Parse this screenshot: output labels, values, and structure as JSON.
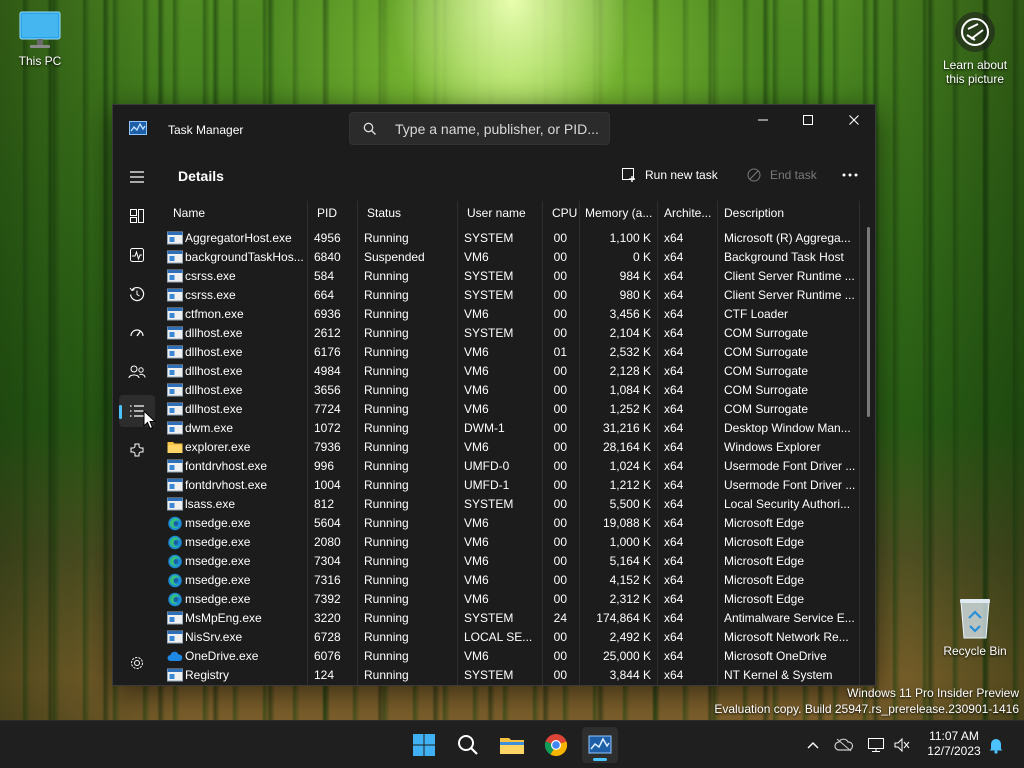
{
  "desktop": {
    "icons": [
      {
        "label": "This PC"
      },
      {
        "label": "Recycle Bin"
      }
    ],
    "learn_about": "Learn about this picture",
    "learn_line1": "Learn about",
    "learn_line2": "this picture",
    "watermark_line1": "Windows 11 Pro Insider Preview",
    "watermark_line2": "Evaluation copy. Build 25947.rs_prerelease.230901-1416"
  },
  "window": {
    "title": "Task Manager",
    "search_placeholder": "Type a name, publisher, or PID..."
  },
  "sidebar": [
    {
      "name": "hamburger-icon",
      "label": "Menu"
    },
    {
      "name": "processes-icon",
      "label": "Processes"
    },
    {
      "name": "performance-icon",
      "label": "Performance"
    },
    {
      "name": "app-history-icon",
      "label": "App history"
    },
    {
      "name": "startup-apps-icon",
      "label": "Startup apps"
    },
    {
      "name": "users-icon",
      "label": "Users"
    },
    {
      "name": "details-icon",
      "label": "Details",
      "active": true
    },
    {
      "name": "services-icon",
      "label": "Services"
    },
    {
      "name": "settings-icon",
      "label": "Settings"
    }
  ],
  "details": {
    "heading": "Details",
    "run_new_task": "Run new task",
    "end_task": "End task",
    "columns": [
      "Name",
      "PID",
      "Status",
      "User name",
      "CPU",
      "Memory (a...",
      "Archite...",
      "Description"
    ],
    "rows": [
      {
        "icon": "app-icon",
        "name": "AggregatorHost.exe",
        "pid": "4956",
        "status": "Running",
        "user": "SYSTEM",
        "cpu": "00",
        "mem": "1,100 K",
        "arch": "x64",
        "desc": "Microsoft (R) Aggrega..."
      },
      {
        "icon": "app-icon",
        "name": "backgroundTaskHos...",
        "pid": "6840",
        "status": "Suspended",
        "user": "VM6",
        "cpu": "00",
        "mem": "0 K",
        "arch": "x64",
        "desc": "Background Task Host"
      },
      {
        "icon": "app-icon",
        "name": "csrss.exe",
        "pid": "584",
        "status": "Running",
        "user": "SYSTEM",
        "cpu": "00",
        "mem": "984 K",
        "arch": "x64",
        "desc": "Client Server Runtime ..."
      },
      {
        "icon": "app-icon",
        "name": "csrss.exe",
        "pid": "664",
        "status": "Running",
        "user": "SYSTEM",
        "cpu": "00",
        "mem": "980 K",
        "arch": "x64",
        "desc": "Client Server Runtime ..."
      },
      {
        "icon": "app-icon",
        "name": "ctfmon.exe",
        "pid": "6936",
        "status": "Running",
        "user": "VM6",
        "cpu": "00",
        "mem": "3,456 K",
        "arch": "x64",
        "desc": "CTF Loader"
      },
      {
        "icon": "app-icon",
        "name": "dllhost.exe",
        "pid": "2612",
        "status": "Running",
        "user": "SYSTEM",
        "cpu": "00",
        "mem": "2,104 K",
        "arch": "x64",
        "desc": "COM Surrogate"
      },
      {
        "icon": "app-icon",
        "name": "dllhost.exe",
        "pid": "6176",
        "status": "Running",
        "user": "VM6",
        "cpu": "01",
        "mem": "2,532 K",
        "arch": "x64",
        "desc": "COM Surrogate"
      },
      {
        "icon": "app-icon",
        "name": "dllhost.exe",
        "pid": "4984",
        "status": "Running",
        "user": "VM6",
        "cpu": "00",
        "mem": "2,128 K",
        "arch": "x64",
        "desc": "COM Surrogate"
      },
      {
        "icon": "app-icon",
        "name": "dllhost.exe",
        "pid": "3656",
        "status": "Running",
        "user": "VM6",
        "cpu": "00",
        "mem": "1,084 K",
        "arch": "x64",
        "desc": "COM Surrogate"
      },
      {
        "icon": "app-icon",
        "name": "dllhost.exe",
        "pid": "7724",
        "status": "Running",
        "user": "VM6",
        "cpu": "00",
        "mem": "1,252 K",
        "arch": "x64",
        "desc": "COM Surrogate"
      },
      {
        "icon": "app-icon",
        "name": "dwm.exe",
        "pid": "1072",
        "status": "Running",
        "user": "DWM-1",
        "cpu": "00",
        "mem": "31,216 K",
        "arch": "x64",
        "desc": "Desktop Window Man..."
      },
      {
        "icon": "folder-icon",
        "name": "explorer.exe",
        "pid": "7936",
        "status": "Running",
        "user": "VM6",
        "cpu": "00",
        "mem": "28,164 K",
        "arch": "x64",
        "desc": "Windows Explorer"
      },
      {
        "icon": "app-icon",
        "name": "fontdrvhost.exe",
        "pid": "996",
        "status": "Running",
        "user": "UMFD-0",
        "cpu": "00",
        "mem": "1,024 K",
        "arch": "x64",
        "desc": "Usermode Font Driver ..."
      },
      {
        "icon": "app-icon",
        "name": "fontdrvhost.exe",
        "pid": "1004",
        "status": "Running",
        "user": "UMFD-1",
        "cpu": "00",
        "mem": "1,212 K",
        "arch": "x64",
        "desc": "Usermode Font Driver ..."
      },
      {
        "icon": "app-icon",
        "name": "lsass.exe",
        "pid": "812",
        "status": "Running",
        "user": "SYSTEM",
        "cpu": "00",
        "mem": "5,500 K",
        "arch": "x64",
        "desc": "Local Security Authori..."
      },
      {
        "icon": "edge-icon",
        "name": "msedge.exe",
        "pid": "5604",
        "status": "Running",
        "user": "VM6",
        "cpu": "00",
        "mem": "19,088 K",
        "arch": "x64",
        "desc": "Microsoft Edge"
      },
      {
        "icon": "edge-icon",
        "name": "msedge.exe",
        "pid": "2080",
        "status": "Running",
        "user": "VM6",
        "cpu": "00",
        "mem": "1,000 K",
        "arch": "x64",
        "desc": "Microsoft Edge"
      },
      {
        "icon": "edge-icon",
        "name": "msedge.exe",
        "pid": "7304",
        "status": "Running",
        "user": "VM6",
        "cpu": "00",
        "mem": "5,164 K",
        "arch": "x64",
        "desc": "Microsoft Edge"
      },
      {
        "icon": "edge-icon",
        "name": "msedge.exe",
        "pid": "7316",
        "status": "Running",
        "user": "VM6",
        "cpu": "00",
        "mem": "4,152 K",
        "arch": "x64",
        "desc": "Microsoft Edge"
      },
      {
        "icon": "edge-icon",
        "name": "msedge.exe",
        "pid": "7392",
        "status": "Running",
        "user": "VM6",
        "cpu": "00",
        "mem": "2,312 K",
        "arch": "x64",
        "desc": "Microsoft Edge"
      },
      {
        "icon": "app-icon",
        "name": "MsMpEng.exe",
        "pid": "3220",
        "status": "Running",
        "user": "SYSTEM",
        "cpu": "24",
        "mem": "174,864 K",
        "arch": "x64",
        "desc": "Antimalware Service E..."
      },
      {
        "icon": "app-icon",
        "name": "NisSrv.exe",
        "pid": "6728",
        "status": "Running",
        "user": "LOCAL SE...",
        "cpu": "00",
        "mem": "2,492 K",
        "arch": "x64",
        "desc": "Microsoft Network Re..."
      },
      {
        "icon": "onedrive-icon",
        "name": "OneDrive.exe",
        "pid": "6076",
        "status": "Running",
        "user": "VM6",
        "cpu": "00",
        "mem": "25,000 K",
        "arch": "x64",
        "desc": "Microsoft OneDrive"
      },
      {
        "icon": "app-icon",
        "name": "Registry",
        "pid": "124",
        "status": "Running",
        "user": "SYSTEM",
        "cpu": "00",
        "mem": "3,844 K",
        "arch": "x64",
        "desc": "NT Kernel & System"
      }
    ]
  },
  "taskbar": {
    "apps": [
      {
        "name": "start-icon"
      },
      {
        "name": "search-icon"
      },
      {
        "name": "file-explorer-icon"
      },
      {
        "name": "chrome-icon"
      },
      {
        "name": "task-manager-icon",
        "active": true
      }
    ],
    "time": "11:07 AM",
    "date": "12/7/2023"
  },
  "colors": {
    "accent": "#4cc2ff",
    "window_bg": "#1c1c1c",
    "taskbar_bg": "#1f1f1f"
  }
}
